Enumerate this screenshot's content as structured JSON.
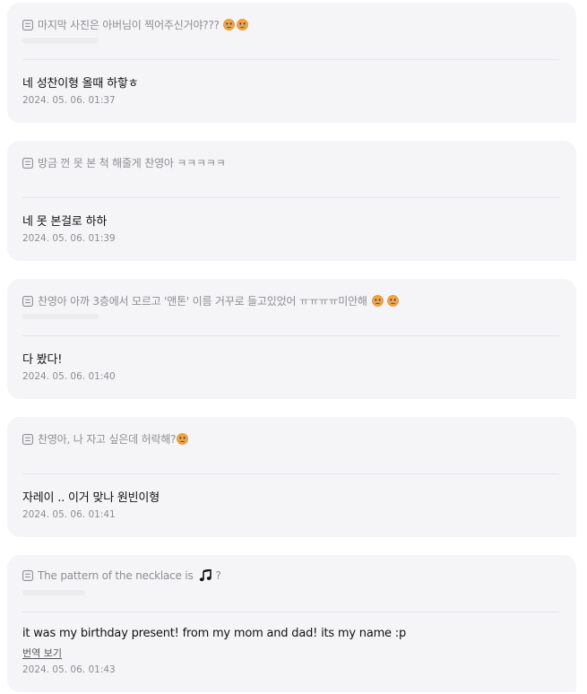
{
  "cards": [
    {
      "question": "마지막 사진은 아버님이 찍어주신거야???",
      "question_emojis": [
        "sad-face",
        "sad-face"
      ],
      "answer": "네 성찬이형 올때 하핳ㅎ",
      "timestamp": "2024. 05. 06. 01:37"
    },
    {
      "question": "방금 껀 못 본 척 해줄게 찬영아 ㅋㅋㅋㅋㅋ",
      "answer": "네 못 본걸로 하하",
      "timestamp": "2024. 05. 06. 01:39"
    },
    {
      "question": "찬영아 아까 3층에서 모르고 '앤톤' 이름 거꾸로 들고있었어 ㅠㅠㅠㅠ미안해",
      "question_emojis": [
        "sad-face",
        "sad-face"
      ],
      "answer": "다 봤다!",
      "timestamp": "2024. 05. 06. 01:40"
    },
    {
      "question": "찬영아, 나 자고 싶은데 허락해?",
      "question_emojis": [
        "sad-face"
      ],
      "answer": "자레이 .. 이거 맞나 원빈이형",
      "timestamp": "2024. 05. 06. 01:41"
    },
    {
      "question_prefix": "The pattern of the necklace is",
      "question_suffix": "?",
      "question_icon": "music-note-icon",
      "answer": "it was my birthday present! from my mom and dad! its my name :p",
      "translate_label": "번역 보기",
      "timestamp": "2024. 05. 06. 01:43"
    }
  ],
  "colors": {
    "card_bg": "#f5f5f7",
    "muted_text": "#8e8e93",
    "answer_text": "#111111",
    "emoji_face": "#f5a623"
  }
}
